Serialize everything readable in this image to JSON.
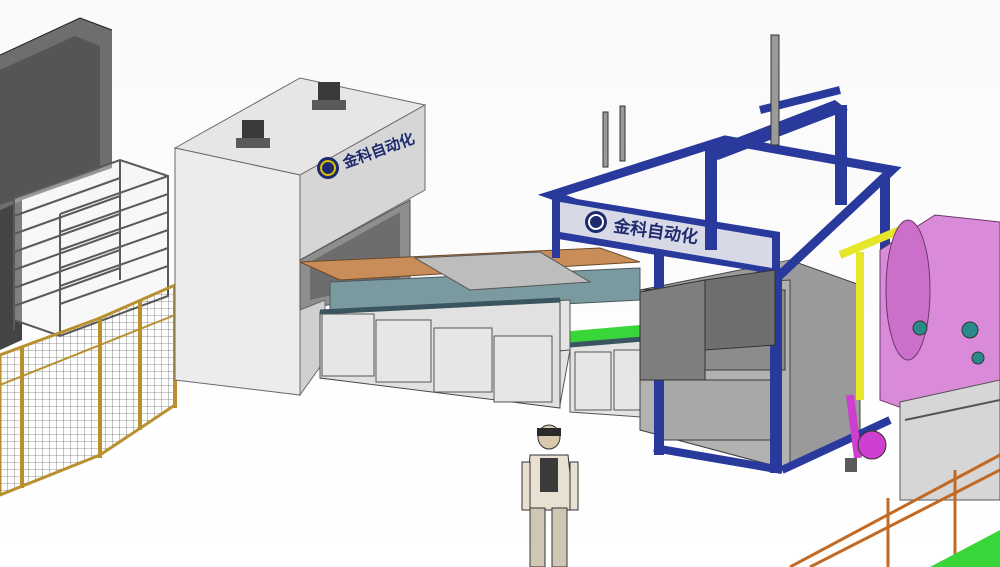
{
  "image": {
    "kind": "3D CAD render of an automated production line",
    "colors": {
      "background": "#ffffff",
      "press_body": "#dcdcdc",
      "press_front": "#ececec",
      "blue_frame": "#2a3a9c",
      "cabinet": "#e3e3e3",
      "guard_mesh": "#b8912e",
      "tank": "#d98ad8",
      "green": "#39d639",
      "yellow": "#e6e62a",
      "worker_shirt": "#e8e1d2",
      "worker_pants": "#cfc7b3"
    }
  },
  "labels": {
    "press_logo": "金科自动化",
    "frame_logo": "金科自动化"
  }
}
